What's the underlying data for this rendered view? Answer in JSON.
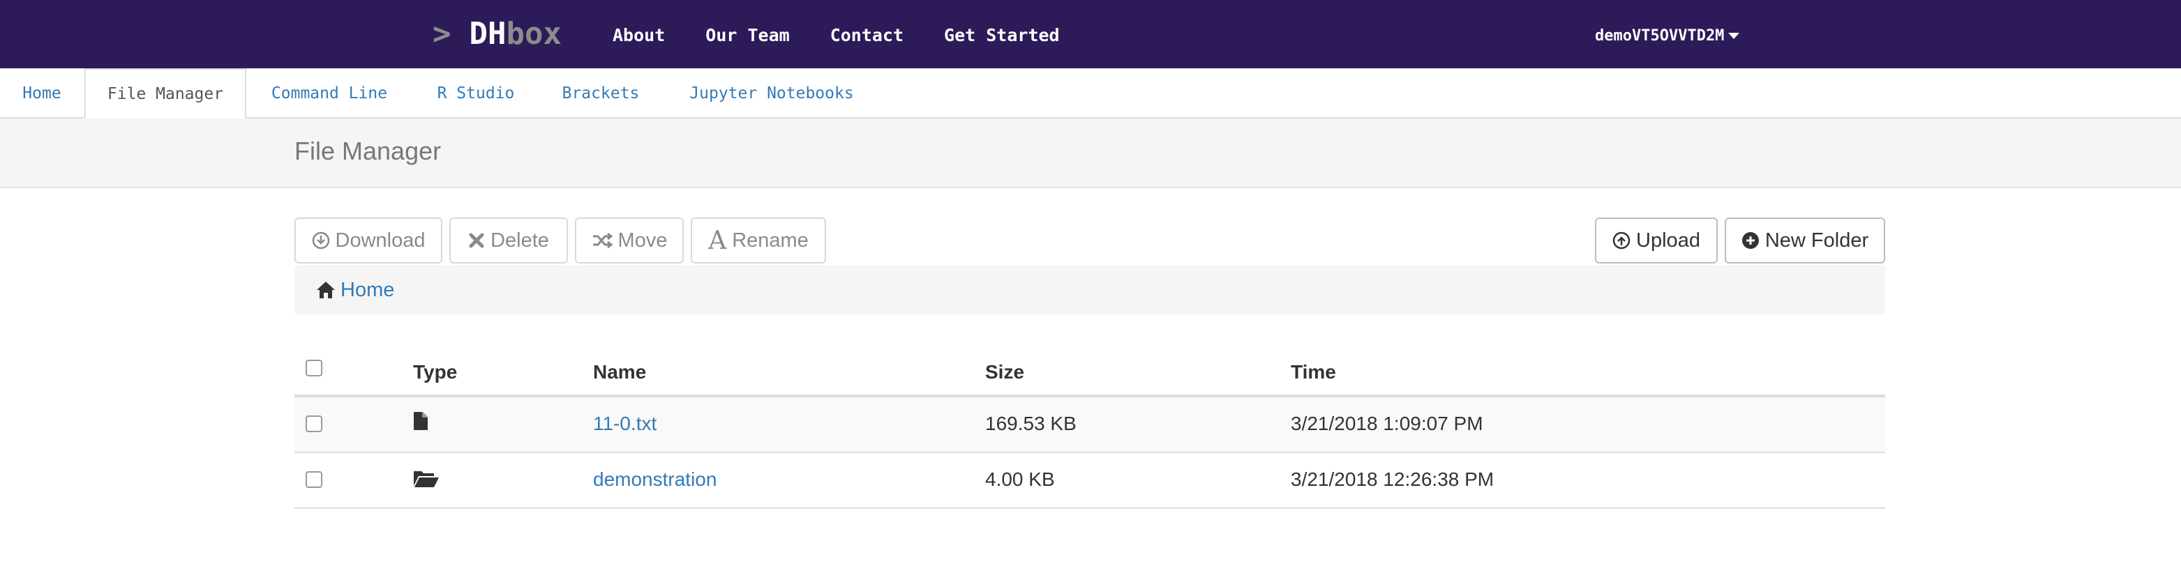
{
  "navbar": {
    "brand_prompt": ">",
    "brand_dh": "DH",
    "brand_box": "box",
    "links": [
      "About",
      "Our Team",
      "Contact",
      "Get Started"
    ],
    "user": "demoVT5OVVTD2M"
  },
  "tabs": {
    "items": [
      "Home",
      "File Manager",
      "Command Line",
      "R Studio",
      "Brackets",
      "Jupyter Notebooks"
    ],
    "active": "File Manager"
  },
  "page": {
    "title": "File Manager"
  },
  "toolbar": {
    "download": "Download",
    "delete": "Delete",
    "move": "Move",
    "rename": "Rename",
    "upload": "Upload",
    "new_folder": "New Folder",
    "rename_glyph": "A"
  },
  "breadcrumb": {
    "home": "Home"
  },
  "table": {
    "headers": {
      "type": "Type",
      "name": "Name",
      "size": "Size",
      "time": "Time"
    },
    "rows": [
      {
        "type_icon": "file-icon",
        "name": "11-0.txt",
        "size": "169.53 KB",
        "time": "3/21/2018 1:09:07 PM"
      },
      {
        "type_icon": "folder-open-icon",
        "name": "demonstration",
        "size": "4.00 KB",
        "time": "3/21/2018 12:26:38 PM"
      }
    ]
  },
  "colors": {
    "navbar_bg": "#2d1a59",
    "link": "#337ab7",
    "panel_bg": "#f5f5f5"
  }
}
